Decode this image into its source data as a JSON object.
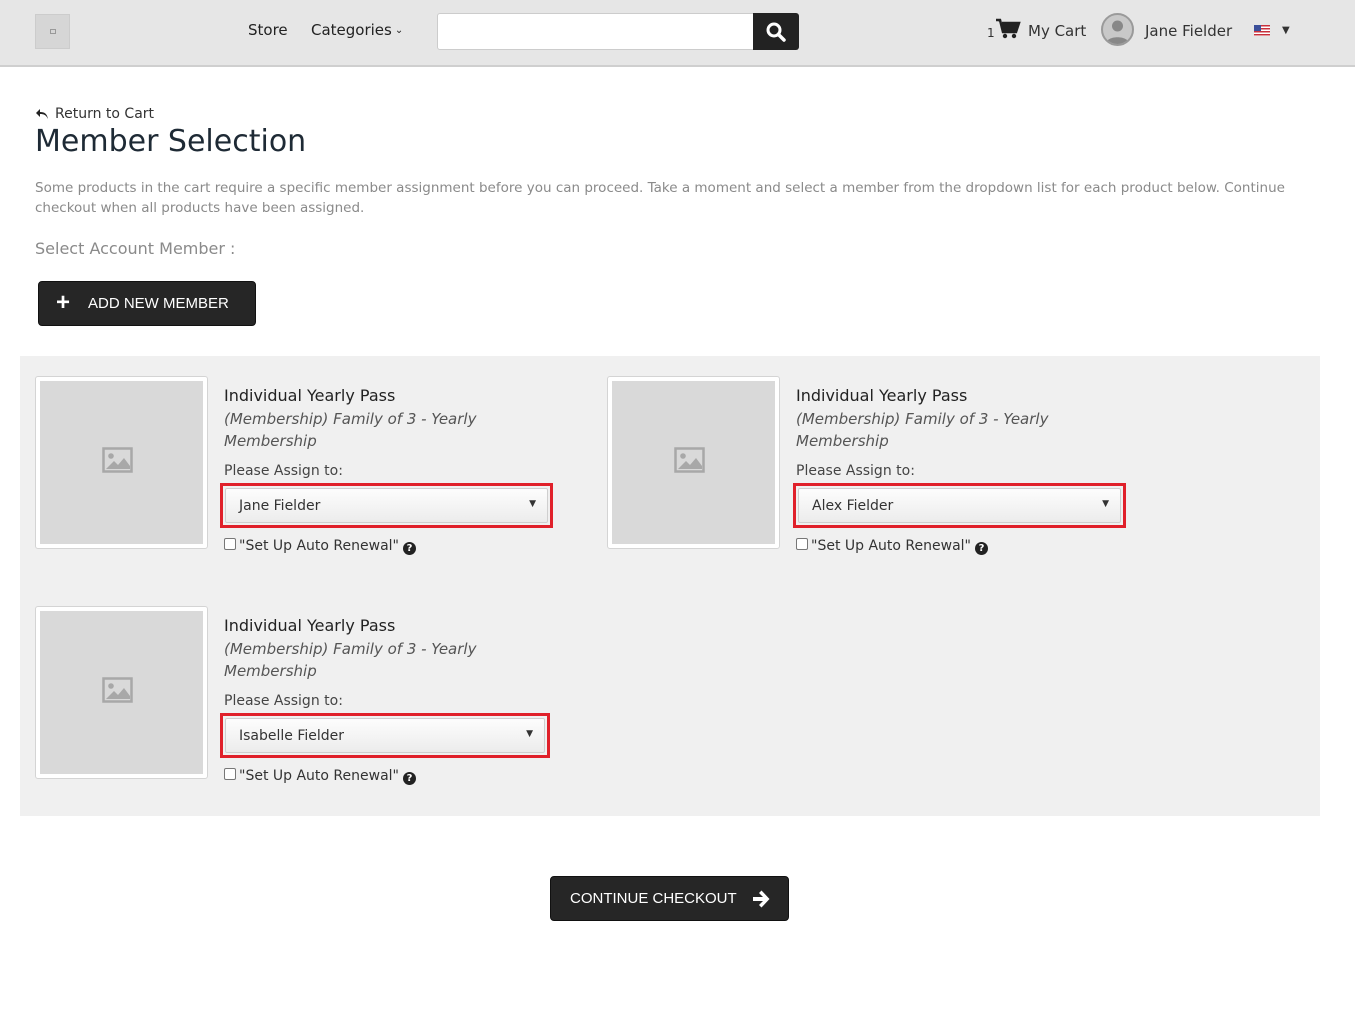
{
  "header": {
    "nav_store": "Store",
    "nav_categories": "Categories",
    "search_placeholder": "",
    "cart_count": "1",
    "cart_label": "My Cart",
    "user_name": "Jane Fielder"
  },
  "page": {
    "return_link": "Return to Cart",
    "title": "Member Selection",
    "intro": "Some products in the cart require a specific member assignment before you can proceed. Take a moment and select a member from the dropdown list for each product below. Continue checkout when all products have been assigned.",
    "select_label": "Select Account Member :",
    "add_member_button": "ADD NEW MEMBER",
    "continue_button": "CONTINUE CHECKOUT"
  },
  "products": [
    {
      "name": "Individual Yearly Pass",
      "description": "(Membership) Family of 3 - Yearly Membership",
      "assign_label": "Please Assign to:",
      "assigned_member": "Jane Fielder",
      "auto_renewal_label": "\"Set Up Auto Renewal\"",
      "auto_renewal_checked": false
    },
    {
      "name": "Individual Yearly Pass",
      "description": "(Membership) Family of 3 - Yearly Membership",
      "assign_label": "Please Assign to:",
      "assigned_member": "Alex Fielder",
      "auto_renewal_label": "\"Set Up Auto Renewal\"",
      "auto_renewal_checked": false
    },
    {
      "name": "Individual Yearly Pass",
      "description": "(Membership) Family of 3 - Yearly Membership",
      "assign_label": "Please Assign to:",
      "assigned_member": "Isabelle Fielder",
      "auto_renewal_label": "\"Set Up Auto Renewal\"",
      "auto_renewal_checked": false
    }
  ],
  "colors": {
    "header_bg": "#e6e6e6",
    "button_bg": "#262626",
    "highlight_border": "#e0202a",
    "panel_bg": "#f0f0f0"
  }
}
